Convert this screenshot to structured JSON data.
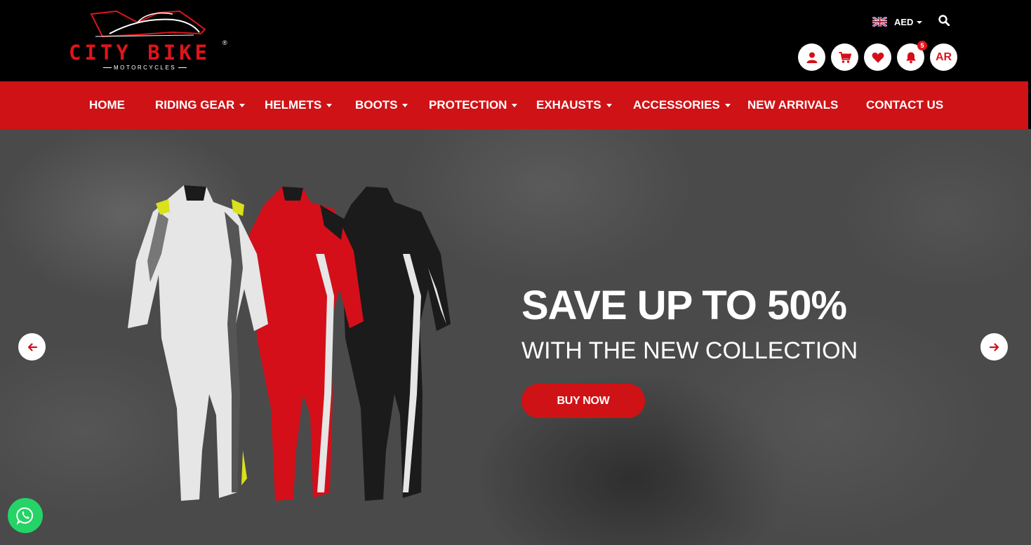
{
  "brand": {
    "name": "CITY BIKE",
    "tagline": "MOTORCYCLES",
    "registered_mark": "®",
    "accent_color": "#cf1216"
  },
  "header": {
    "currency": "AED",
    "language_button": "AR",
    "notifications_count": "5",
    "icons": [
      "flag-uk-icon",
      "search-icon",
      "user-icon",
      "cart-icon",
      "heart-icon",
      "bell-icon"
    ]
  },
  "nav": {
    "items": [
      {
        "label": "HOME",
        "has_dropdown": false
      },
      {
        "label": "RIDING GEAR",
        "has_dropdown": true
      },
      {
        "label": "HELMETS",
        "has_dropdown": true
      },
      {
        "label": "BOOTS",
        "has_dropdown": true
      },
      {
        "label": "PROTECTION",
        "has_dropdown": true
      },
      {
        "label": "EXHAUSTS",
        "has_dropdown": true
      },
      {
        "label": "ACCESSORIES",
        "has_dropdown": true
      },
      {
        "label": "NEW ARRIVALS",
        "has_dropdown": false
      },
      {
        "label": "CONTACT US",
        "has_dropdown": false
      }
    ]
  },
  "hero": {
    "headline": "SAVE UP TO 50%",
    "subheadline": "WITH THE NEW COLLECTION",
    "cta_label": "BUY NOW",
    "product_colors": [
      "#e6e6e6",
      "#d40f1a",
      "#1b1b1b"
    ]
  },
  "widgets": {
    "chat_icon": "whatsapp-icon"
  }
}
